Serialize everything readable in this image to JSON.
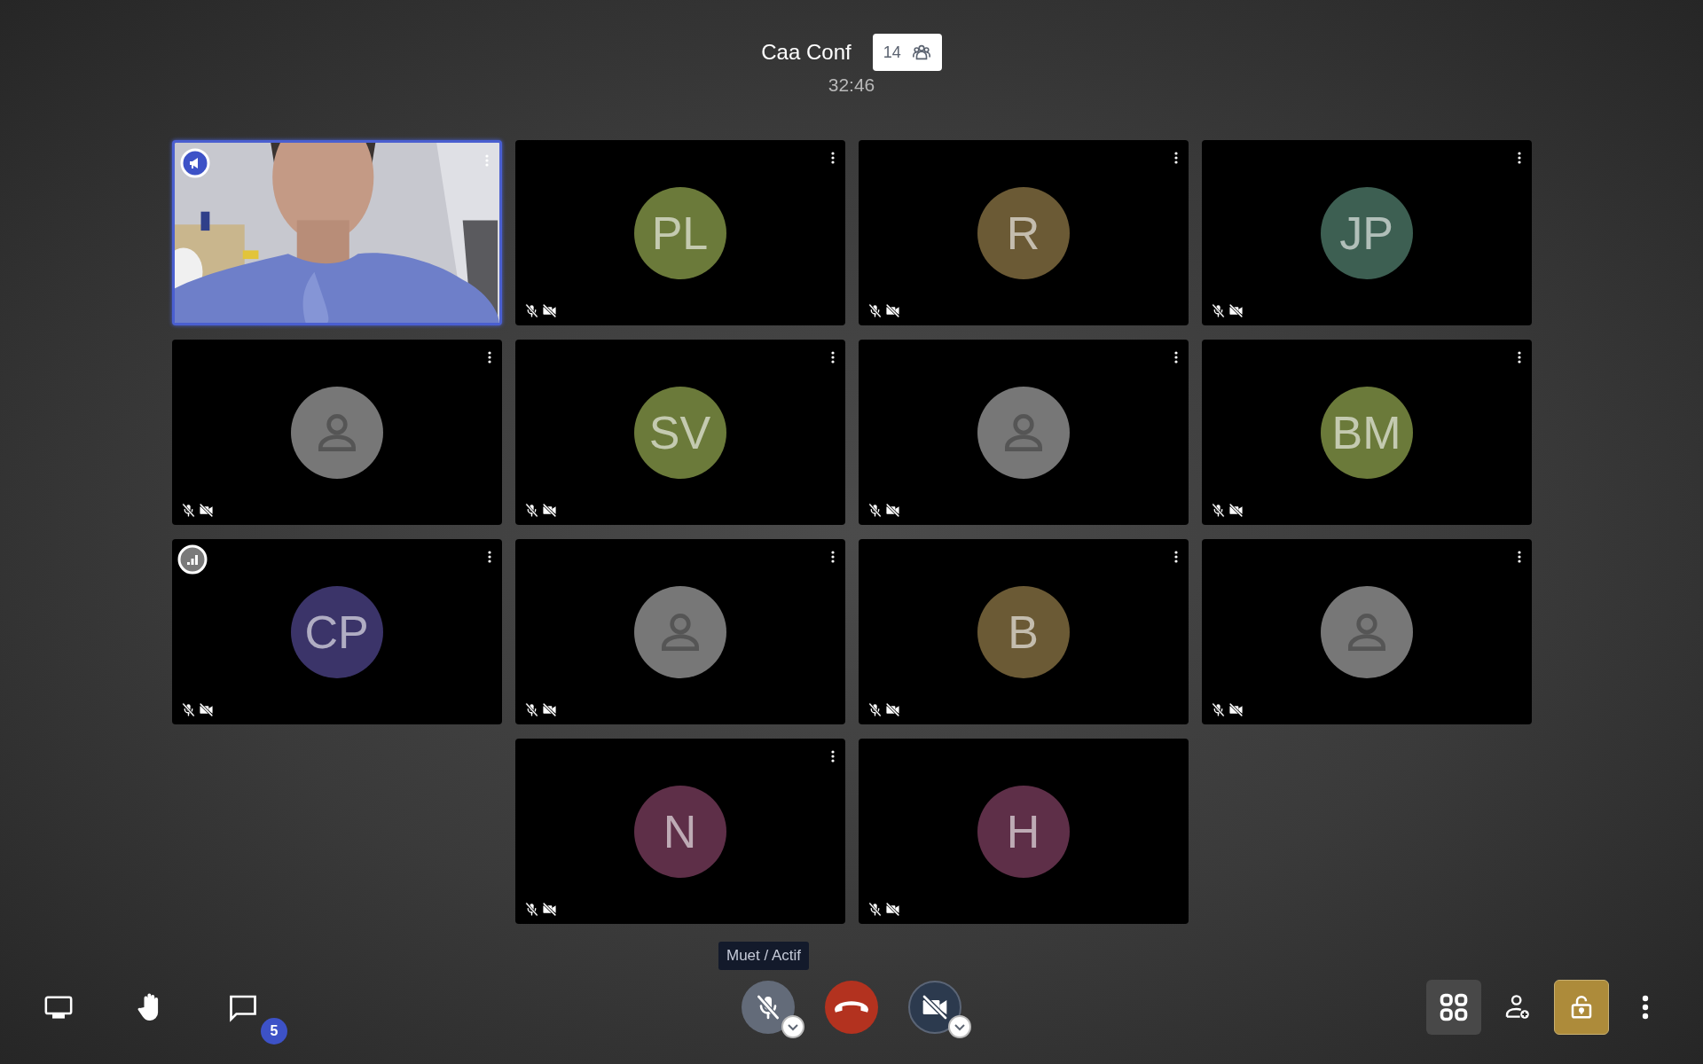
{
  "header": {
    "title": "Caa Conf",
    "participant_count": "14",
    "timer": "32:46"
  },
  "tiles": [
    {
      "kind": "video",
      "active_speaker": true,
      "speaker_badge": true,
      "menu": true,
      "mic_muted": false,
      "camera_off": false
    },
    {
      "kind": "initials",
      "initials": "PL",
      "color": "#6b7a3a",
      "active_speaker": false,
      "menu": true,
      "mic_muted": true,
      "camera_off": true
    },
    {
      "kind": "initials",
      "initials": "R",
      "color": "#6b5a35",
      "active_speaker": false,
      "menu": true,
      "mic_muted": true,
      "camera_off": true
    },
    {
      "kind": "initials",
      "initials": "JP",
      "color": "#3d5f52",
      "active_speaker": false,
      "menu": true,
      "mic_muted": true,
      "camera_off": true
    },
    {
      "kind": "placeholder",
      "active_speaker": false,
      "menu": true,
      "mic_muted": true,
      "camera_off": true
    },
    {
      "kind": "initials",
      "initials": "SV",
      "color": "#6b7a3a",
      "active_speaker": false,
      "menu": true,
      "mic_muted": true,
      "camera_off": true
    },
    {
      "kind": "placeholder",
      "active_speaker": false,
      "menu": true,
      "mic_muted": true,
      "camera_off": true
    },
    {
      "kind": "initials",
      "initials": "BM",
      "color": "#6b7a3a",
      "active_speaker": false,
      "menu": true,
      "mic_muted": true,
      "camera_off": true
    },
    {
      "kind": "initials",
      "initials": "CP",
      "color": "#3b3469",
      "active_speaker": false,
      "connection_badge": true,
      "menu": true,
      "mic_muted": true,
      "camera_off": true
    },
    {
      "kind": "placeholder",
      "active_speaker": false,
      "menu": true,
      "mic_muted": true,
      "camera_off": true
    },
    {
      "kind": "initials",
      "initials": "B",
      "color": "#6b5a35",
      "active_speaker": false,
      "menu": true,
      "mic_muted": true,
      "camera_off": true
    },
    {
      "kind": "placeholder",
      "active_speaker": false,
      "menu": true,
      "mic_muted": true,
      "camera_off": true
    },
    {
      "kind": "initials",
      "initials": "N",
      "color": "#5e2f48",
      "active_speaker": false,
      "menu": true,
      "mic_muted": true,
      "camera_off": true
    },
    {
      "kind": "initials",
      "initials": "H",
      "color": "#5e2f48",
      "active_speaker": false,
      "menu": false,
      "mic_muted": true,
      "camera_off": true
    }
  ],
  "toolbar": {
    "left": [
      {
        "kind": "screen-share"
      },
      {
        "kind": "raise-hand"
      },
      {
        "kind": "chat",
        "badge": "5"
      }
    ],
    "tooltip": "Muet / Actif",
    "center": [
      {
        "kind": "microphone",
        "muted": true
      },
      {
        "kind": "hangup"
      },
      {
        "kind": "camera",
        "off": true
      }
    ],
    "right": [
      {
        "kind": "tile-view",
        "selected": true
      },
      {
        "kind": "invite"
      },
      {
        "kind": "security",
        "active": true
      },
      {
        "kind": "more"
      }
    ]
  }
}
